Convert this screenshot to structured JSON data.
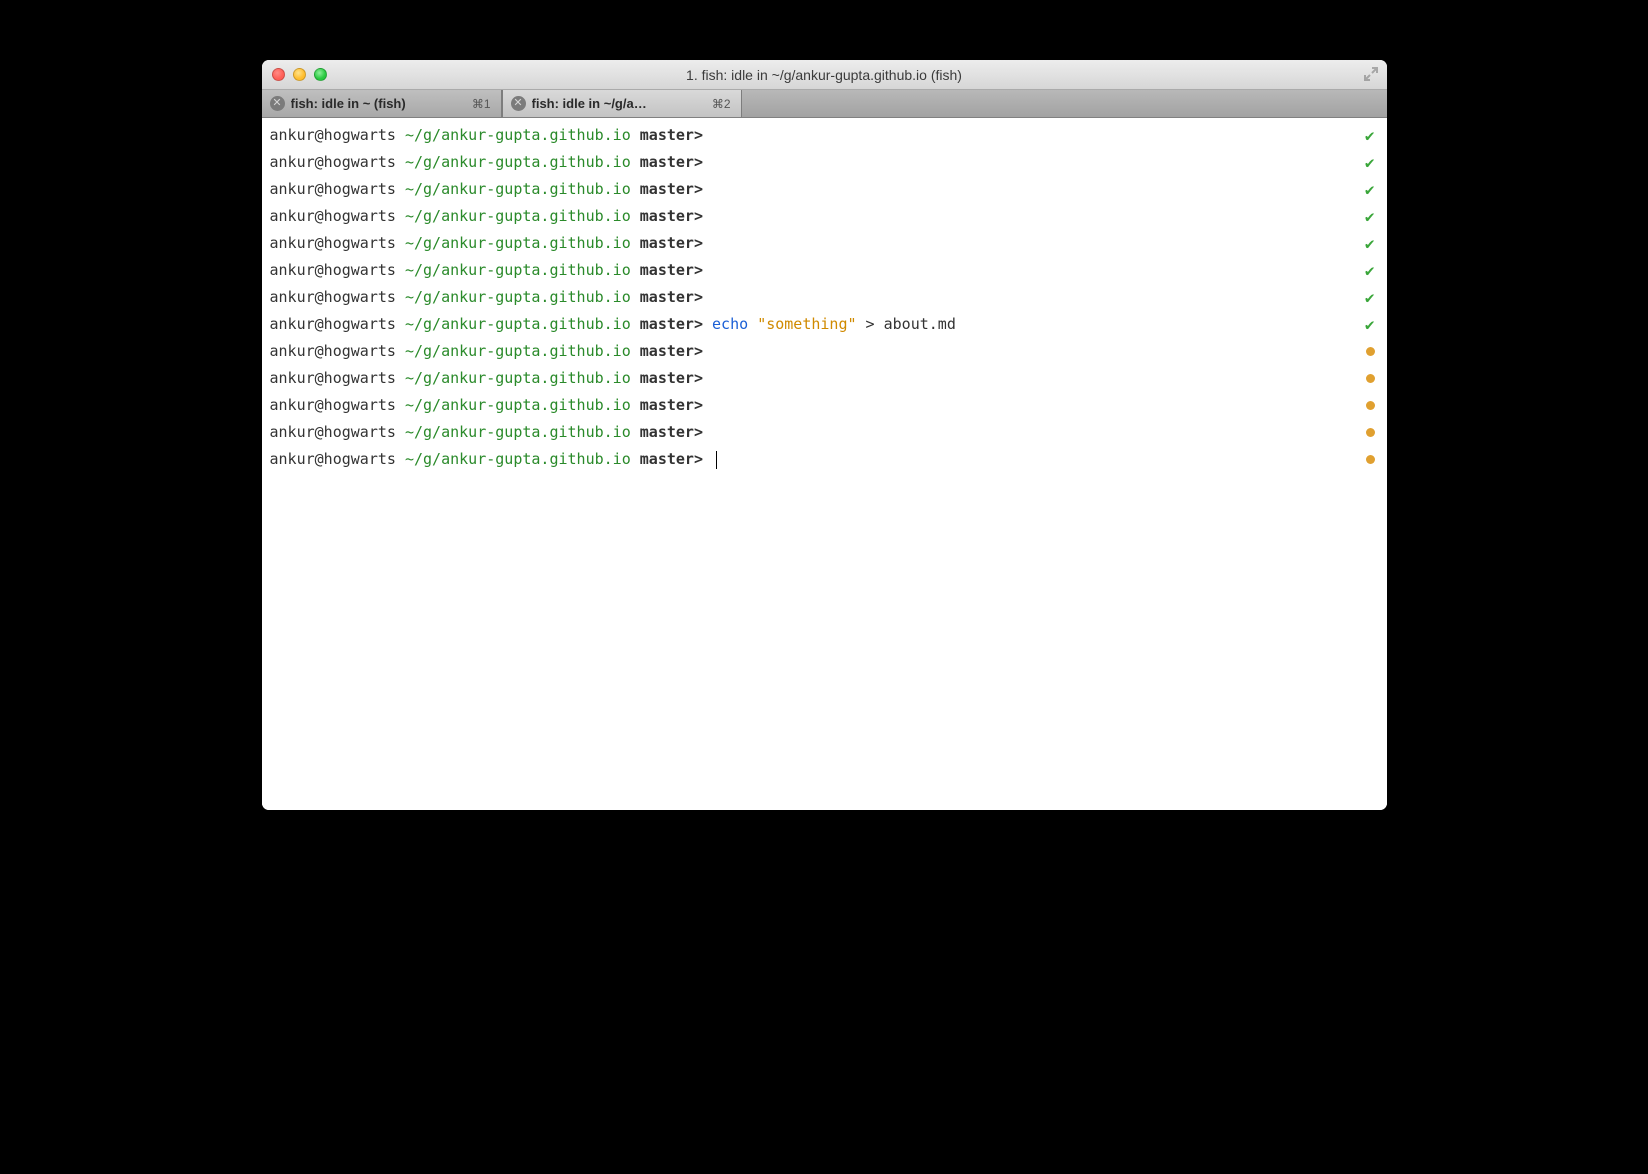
{
  "window": {
    "title": "1. fish: idle in ~/g/ankur-gupta.github.io (fish)"
  },
  "tabs": [
    {
      "label": "fish: idle in ~ (fish)",
      "shortcut": "⌘1",
      "active": false
    },
    {
      "label": "fish: idle in ~/g/a…",
      "shortcut": "⌘2",
      "active": true
    }
  ],
  "prompt": {
    "user": "ankur@hogwarts ",
    "path": "~/g/ankur-gupta.github.io",
    "branch": " master",
    "gt": "> "
  },
  "lines": [
    {
      "cmd": null,
      "status": "check"
    },
    {
      "cmd": null,
      "status": "check"
    },
    {
      "cmd": null,
      "status": "check"
    },
    {
      "cmd": null,
      "status": "check"
    },
    {
      "cmd": null,
      "status": "check"
    },
    {
      "cmd": null,
      "status": "check"
    },
    {
      "cmd": null,
      "status": "check"
    },
    {
      "cmd": {
        "echo": "echo ",
        "str": "\"something\"",
        "rest": " > about.md"
      },
      "status": "check"
    },
    {
      "cmd": null,
      "status": "dot"
    },
    {
      "cmd": null,
      "status": "dot"
    },
    {
      "cmd": null,
      "status": "dot"
    },
    {
      "cmd": null,
      "status": "dot"
    },
    {
      "cmd": null,
      "status": "dot",
      "cursor": true
    }
  ],
  "glyphs": {
    "check": "✔",
    "close": "✕"
  }
}
